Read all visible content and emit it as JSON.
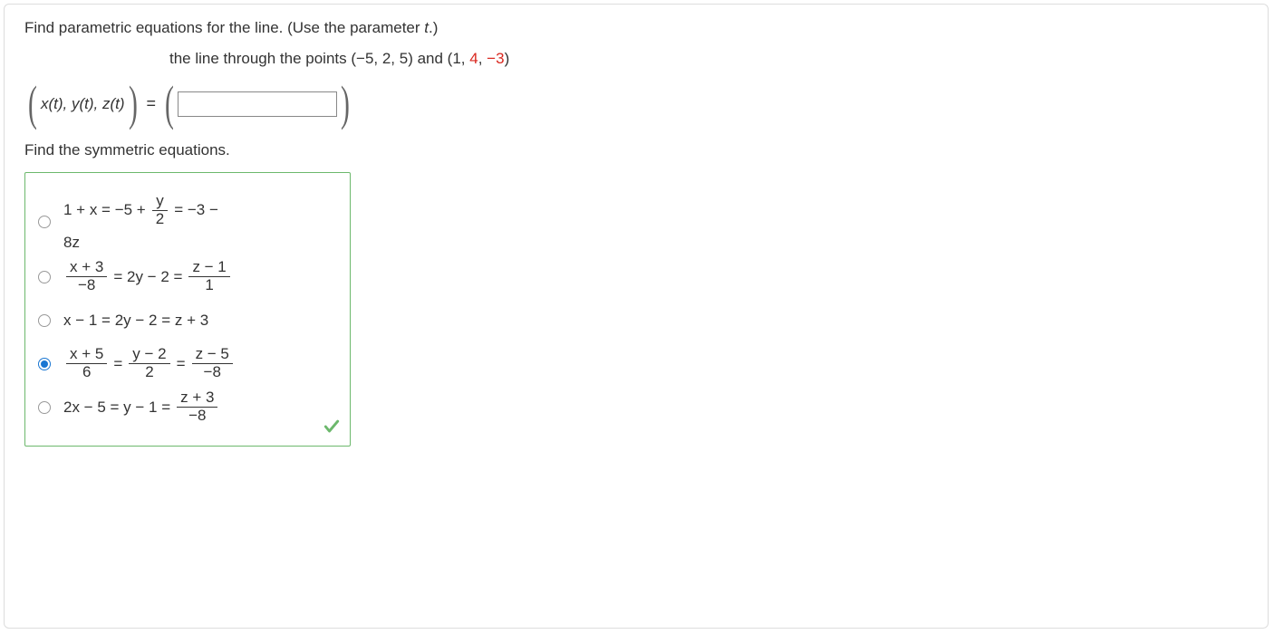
{
  "question": {
    "prompt": "Find parametric equations for the line. (Use the parameter ",
    "param": "t",
    "prompt_end": ".)",
    "line_through_pre": "the line through the points (−5, 2, 5) and (1, ",
    "red1": "4",
    "mid": ", ",
    "red2": "−3",
    "line_through_post": ")",
    "func_tuple_inner": "x(t), y(t), z(t)",
    "equals": "=",
    "prompt2": "Find the symmetric equations."
  },
  "options": {
    "opt1": {
      "part_a": "1 + x = −5 +",
      "frac1_num": "y",
      "frac1_den": "2",
      "part_b": "= −3 −",
      "line2": "8z"
    },
    "opt2": {
      "f1_num": "x + 3",
      "f1_den": "−8",
      "mid": "= 2y − 2 =",
      "f2_num": "z − 1",
      "f2_den": "1"
    },
    "opt3": {
      "text": "x − 1 = 2y − 2 = z + 3"
    },
    "opt4": {
      "f1_num": "x + 5",
      "f1_den": "6",
      "eq1": "=",
      "f2_num": "y − 2",
      "f2_den": "2",
      "eq2": "=",
      "f3_num": "z − 5",
      "f3_den": "−8"
    },
    "opt5": {
      "pre": "2x − 5 = y − 1 =",
      "f_num": "z + 3",
      "f_den": "−8"
    }
  },
  "selected": "opt4",
  "correct": true
}
